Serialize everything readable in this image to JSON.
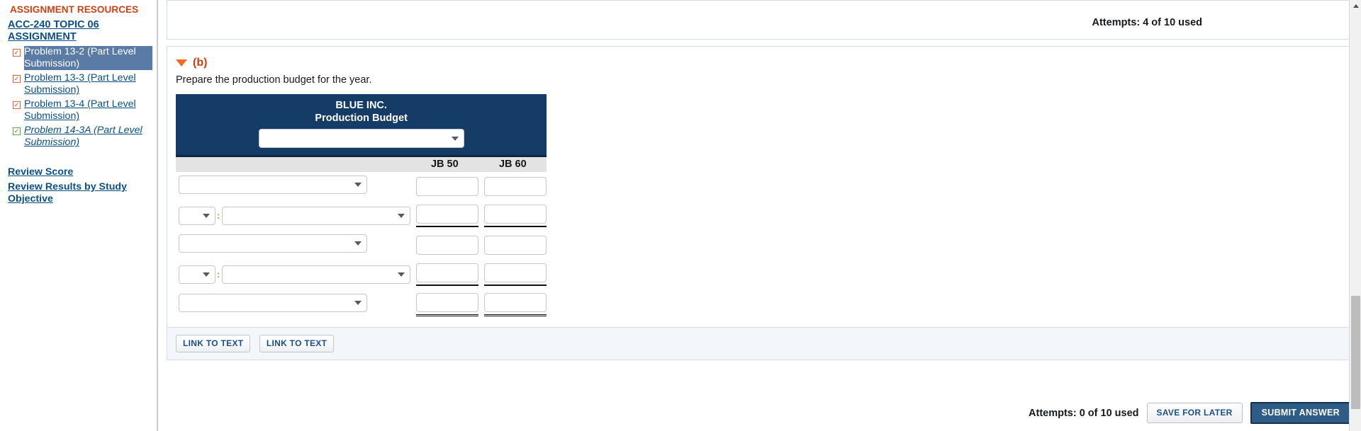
{
  "sidebar": {
    "resources_title": "ASSIGNMENT RESOURCES",
    "assignment_link": "ACC-240 TOPIC 06 ASSIGNMENT",
    "problems": [
      {
        "label": "Problem 13-2 (Part Level Submission)",
        "state": "orange",
        "selected": true,
        "italic": false
      },
      {
        "label": "Problem 13-3 (Part Level Submission)",
        "state": "orange",
        "selected": false,
        "italic": false
      },
      {
        "label": "Problem 13-4 (Part Level Submission)",
        "state": "orange",
        "selected": false,
        "italic": false
      },
      {
        "label": "Problem 14-3A (Part Level Submission)",
        "state": "green",
        "selected": false,
        "italic": true
      }
    ],
    "review_score": "Review Score",
    "review_results": "Review Results by Study Objective"
  },
  "top_panel": {
    "attempts": "Attempts: 4 of 10 used"
  },
  "section": {
    "marker": "(b)",
    "instruction": "Prepare the production budget for the year."
  },
  "budget_table": {
    "company": "BLUE INC.",
    "title": "Production Budget",
    "header_select_value": "",
    "columns": [
      "",
      "JB 50",
      "JB 60"
    ],
    "rows": [
      {
        "type": "single",
        "select_value": "",
        "jb50": "",
        "jb60": "",
        "rule": "none"
      },
      {
        "type": "pair",
        "small_value": "",
        "separator": ":",
        "select_value": "",
        "jb50": "",
        "jb60": "",
        "rule": "single"
      },
      {
        "type": "single",
        "select_value": "",
        "jb50": "",
        "jb60": "",
        "rule": "none"
      },
      {
        "type": "pair",
        "small_value": "",
        "separator": ":",
        "select_value": "",
        "jb50": "",
        "jb60": "",
        "rule": "single"
      },
      {
        "type": "single",
        "select_value": "",
        "jb50": "",
        "jb60": "",
        "rule": "double"
      }
    ]
  },
  "links_bar": {
    "link_to_text_1": "LINK TO TEXT",
    "link_to_text_2": "LINK TO TEXT"
  },
  "footer": {
    "attempts": "Attempts: 0 of 10 used",
    "save_label": "SAVE FOR LATER",
    "submit_label": "SUBMIT ANSWER"
  },
  "colors": {
    "accent_orange": "#cc4011",
    "link_blue": "#0a4f85",
    "table_header_navy": "#143c66",
    "submit_blue": "#2e5c86",
    "selection_blue": "#5a7ba6"
  }
}
